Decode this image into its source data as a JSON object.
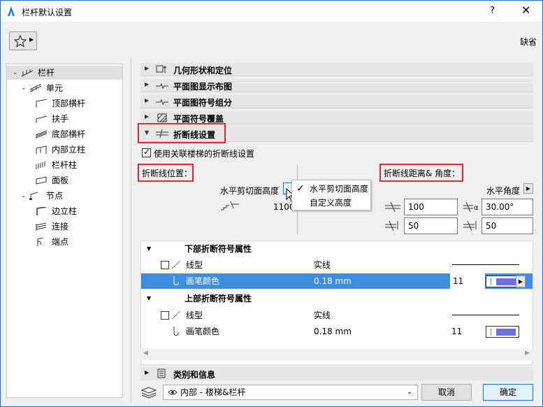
{
  "window": {
    "title": "栏杆默认设置",
    "help": "?",
    "close": "✕"
  },
  "header": {
    "favorites_icon": "star-icon",
    "default_label": "缺省"
  },
  "tree": {
    "items": [
      {
        "label": "栏杆",
        "level": 0
      },
      {
        "label": "单元",
        "level": 1
      },
      {
        "label": "顶部横杆",
        "level": 2
      },
      {
        "label": "扶手",
        "level": 2
      },
      {
        "label": "底部横杆",
        "level": 2
      },
      {
        "label": "内部立柱",
        "level": 2
      },
      {
        "label": "栏杆柱",
        "level": 2
      },
      {
        "label": "面板",
        "level": 2
      },
      {
        "label": "节点",
        "level": 1
      },
      {
        "label": "边立柱",
        "level": 2
      },
      {
        "label": "连接",
        "level": 2
      },
      {
        "label": "端点",
        "level": 2
      }
    ]
  },
  "sections": {
    "geometry": "几何形状和定位",
    "floorplan_display": "平面图显示布图",
    "floorplan_symbol": "平面图符号组分",
    "floorplan_cover": "平面符号覆盖",
    "break_line": "折断线设置",
    "category": "类别和信息"
  },
  "break": {
    "use_stair_checkbox": "使用关联楼梯的折断线设置",
    "use_stair_checked": true,
    "position_label": "折断线位置：",
    "dist_angle_label": "折断线距离& 角度：",
    "horiz_cut_label": "水平剪切面高度",
    "height_value": "1100",
    "horiz_angle_label": "水平角度",
    "dist1": "100",
    "angle": "30.00°",
    "dist2": "50",
    "dist3": "50",
    "alpha": "α"
  },
  "dropdown": {
    "options": [
      "水平剪切面高度",
      "自定义高度"
    ],
    "checkmark": "✓"
  },
  "table": {
    "lower_header": "下部折断符号属性",
    "upper_header": "上部折断符号属性",
    "rows_lower": [
      {
        "name": "线型",
        "value": "实线"
      },
      {
        "name": "画笔颜色",
        "value": "0.18 mm",
        "pen": "11"
      }
    ],
    "rows_upper": [
      {
        "name": "线型",
        "value": "实线"
      },
      {
        "name": "画笔颜色",
        "value": "0.18 mm",
        "pen": "11"
      }
    ]
  },
  "footer": {
    "layer_value": "内部 - 楼梯&栏杆",
    "cancel": "取消",
    "ok": "确定"
  },
  "colors": {
    "accent": "#3d8ee0",
    "highlight_red": "#e8262a",
    "pen_swatch": "#6f6fe0"
  }
}
